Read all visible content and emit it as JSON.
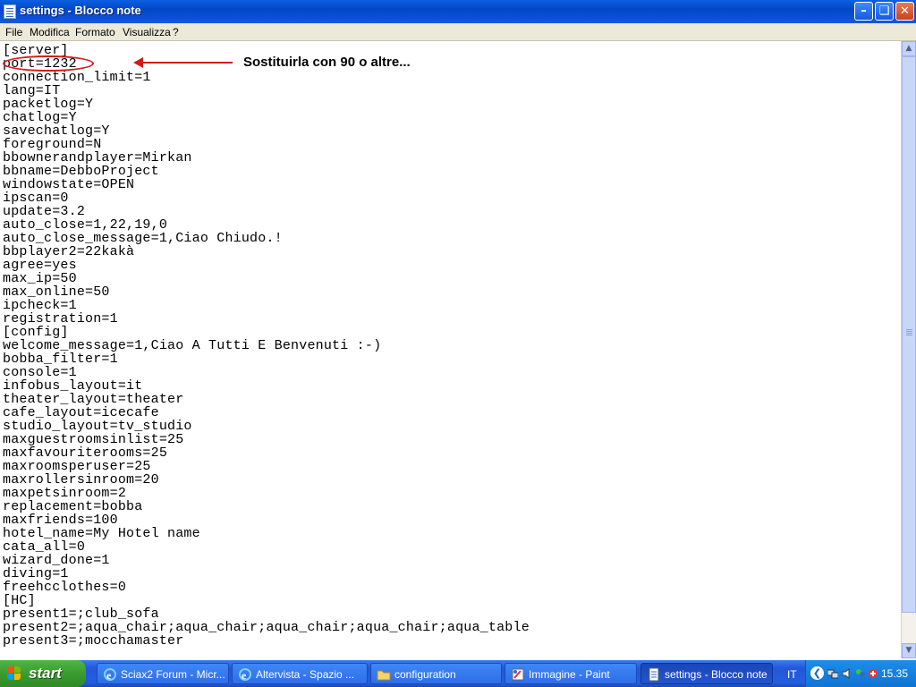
{
  "window": {
    "title": "settings - Blocco note"
  },
  "menu": [
    "File",
    "Modifica",
    "Formato",
    "Visualizza",
    "?"
  ],
  "editor": {
    "lines": [
      "[server]",
      "port=1232",
      "connection_limit=1",
      "lang=IT",
      "packetlog=Y",
      "chatlog=Y",
      "savechatlog=Y",
      "foreground=N",
      "bbownerandplayer=Mirkan",
      "bbname=DebboProject",
      "windowstate=OPEN",
      "ipscan=0",
      "update=3.2",
      "auto_close=1,22,19,0",
      "auto_close_message=1,Ciao Chiudo.!",
      "bbplayer2=22kakà",
      "agree=yes",
      "max_ip=50",
      "max_online=50",
      "ipcheck=1",
      "registration=1",
      "[config]",
      "welcome_message=1,Ciao A Tutti E Benvenuti :-)",
      "bobba_filter=1",
      "console=1",
      "infobus_layout=it",
      "theater_layout=theater",
      "cafe_layout=icecafe",
      "studio_layout=tv_studio",
      "maxguestroomsinlist=25",
      "maxfavouriterooms=25",
      "maxroomsperuser=25",
      "maxrollersinroom=20",
      "maxpetsinroom=2",
      "replacement=bobba",
      "maxfriends=100",
      "hotel_name=My Hotel name",
      "cata_all=0",
      "wizard_done=1",
      "diving=1",
      "freehcclothes=0",
      "[HC]",
      "present1=;club_sofa",
      "present2=;aqua_chair;aqua_chair;aqua_chair;aqua_chair;aqua_table",
      "present3=;mocchamaster"
    ]
  },
  "annotation": {
    "text": "Sostituirla con 90 o altre...",
    "color": "#d41a1a"
  },
  "taskbar": {
    "start_label": "start",
    "tasks": [
      {
        "label": "Sciax2 Forum - Micr...",
        "icon": "internet-explorer-icon"
      },
      {
        "label": "Altervista - Spazio ...",
        "icon": "internet-explorer-icon"
      },
      {
        "label": "configuration",
        "icon": "folder-icon"
      },
      {
        "label": "Immagine - Paint",
        "icon": "paint-icon"
      },
      {
        "label": "settings - Blocco note",
        "icon": "notepad-icon",
        "active": true
      }
    ],
    "language": "IT",
    "clock": "15.35"
  }
}
